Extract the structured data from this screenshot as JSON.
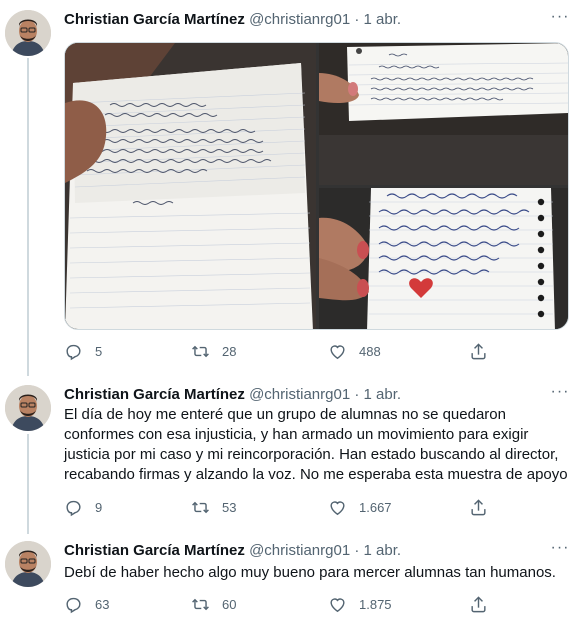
{
  "thread": {
    "tweets": [
      {
        "name": "Christian García Martínez",
        "handle": "@christianrg01",
        "dot": "·",
        "date": "1 abr.",
        "text": "",
        "media": {
          "photo1": "handwritten-letter-1",
          "photo2": "handwritten-letter-2",
          "photo3": "handwritten-letter-3"
        },
        "replies": "5",
        "retweets": "28",
        "likes": "488"
      },
      {
        "name": "Christian García Martínez",
        "handle": "@christianrg01",
        "dot": "·",
        "date": "1 abr.",
        "text": "El día de hoy me enteré que un grupo de alumnas no se quedaron conformes con esa injusticia, y han armado un movimiento para exigir justicia por mi caso y mi reincorporación. Han estado buscando al director, recabando firmas y alzando la voz. No me esperaba esta muestra de apoyo",
        "replies": "9",
        "retweets": "53",
        "likes": "1.667"
      },
      {
        "name": "Christian García Martínez",
        "handle": "@christianrg01",
        "dot": "·",
        "date": "1 abr.",
        "text": "Debí de haber hecho algo muy bueno para mercer alumnas tan humanos.",
        "replies": "63",
        "retweets": "60",
        "likes": "1.875"
      }
    ]
  },
  "icons": {
    "more": "more-icon",
    "reply": "reply-icon",
    "retweet": "retweet-icon",
    "like": "heart-icon",
    "share": "share-icon"
  },
  "colors": {
    "text": "#0f1419",
    "secondary": "#536471",
    "thread_line": "#cfd9de"
  }
}
